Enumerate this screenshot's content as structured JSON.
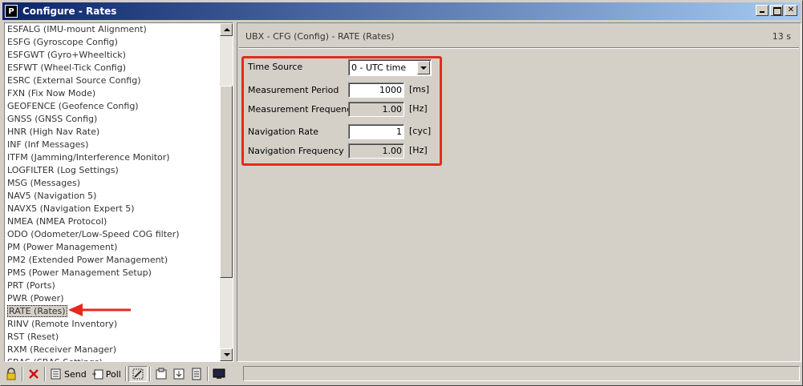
{
  "window": {
    "app_icon_glyph": "P",
    "title": "Configure - Rates"
  },
  "message_list": {
    "items": [
      "ESFALG (IMU-mount Alignment)",
      "ESFG (Gyroscope Config)",
      "ESFGWT (Gyro+Wheeltick)",
      "ESFWT (Wheel-Tick Config)",
      "ESRC (External Source Config)",
      "FXN (Fix Now Mode)",
      "GEOFENCE (Geofence Config)",
      "GNSS (GNSS Config)",
      "HNR (High Nav Rate)",
      "INF (Inf Messages)",
      "ITFM (Jamming/Interference Monitor)",
      "LOGFILTER (Log Settings)",
      "MSG (Messages)",
      "NAV5 (Navigation 5)",
      "NAVX5 (Navigation Expert 5)",
      "NMEA (NMEA Protocol)",
      "ODO (Odometer/Low-Speed COG filter)",
      "PM (Power Management)",
      "PM2 (Extended Power Management)",
      "PMS (Power Management Setup)",
      "PRT (Ports)",
      "PWR (Power)",
      "RATE (Rates)",
      "RINV (Remote Inventory)",
      "RST (Reset)",
      "RXM (Receiver Manager)",
      "SBAS (SBAS Settings)"
    ],
    "selected_index": 22
  },
  "panel": {
    "header": "UBX - CFG (Config) - RATE (Rates)",
    "timer": "13 s",
    "highlight_color": "#e8281e",
    "time_source_label": "Time Source",
    "time_source_value": "0 - UTC time",
    "measurement_period_label": "Measurement Period",
    "measurement_period_value": "1000",
    "measurement_period_unit": "[ms]",
    "measurement_frequency_label": "Measurement Frequency",
    "measurement_frequency_value": "1.00",
    "measurement_frequency_unit": "[Hz]",
    "navigation_rate_label": "Navigation Rate",
    "navigation_rate_value": "1",
    "navigation_rate_unit": "[cyc]",
    "navigation_frequency_label": "Navigation Frequency",
    "navigation_frequency_value": "1.00",
    "navigation_frequency_unit": "[Hz]"
  },
  "toolbar": {
    "send_label": "Send",
    "poll_label": "Poll"
  }
}
